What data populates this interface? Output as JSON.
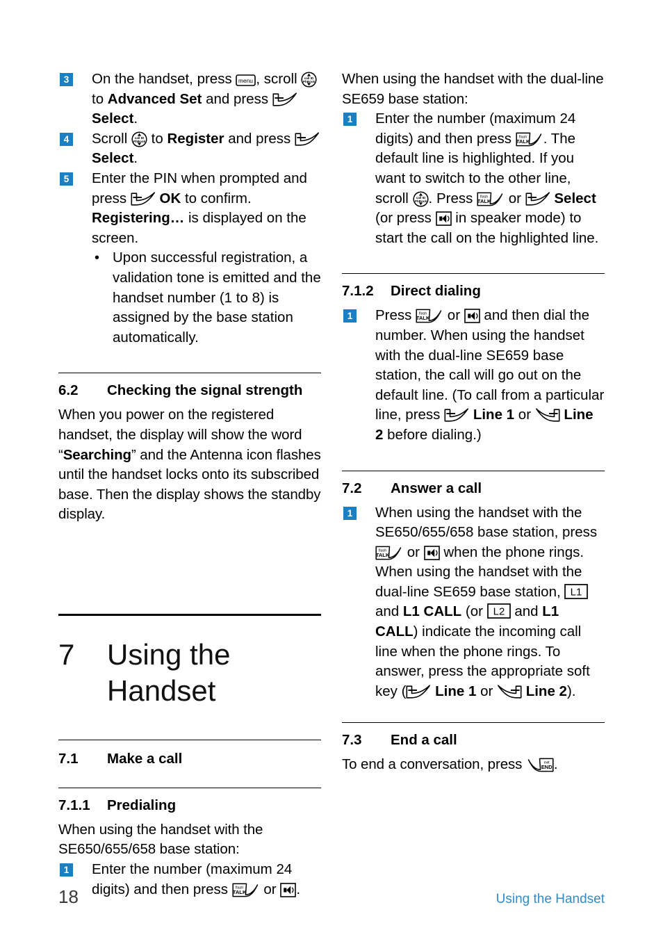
{
  "document": {
    "page_number": "18",
    "footer_title": "Using the Handset",
    "accent_blue": "#1B7FC3",
    "footer_blue": "#2C8ED1"
  },
  "icons": {
    "menu_key": "menu",
    "scroll_key_top": "call ID",
    "scroll_key_bottom": "PhBook",
    "talk_key_top": "flash",
    "talk_key_bottom": "TALK",
    "end_key_top": "exit",
    "end_key_bottom": "END",
    "speaker_key": "speaker-icon",
    "softkey_left": "left-softkey-icon",
    "softkey_right": "right-softkey-icon",
    "line1_key": "L1",
    "line2_key": "L2"
  },
  "left_column": {
    "steps": [
      {
        "num": "3",
        "parts": [
          {
            "t": "text",
            "v": "On the handset, press "
          },
          {
            "t": "icon",
            "v": "menu"
          },
          {
            "t": "text",
            "v": ", scroll "
          },
          {
            "t": "icon",
            "v": "scroll"
          },
          {
            "t": "text",
            "v": " to "
          },
          {
            "t": "bold",
            "v": "Advanced Set"
          },
          {
            "t": "text",
            "v": " and press "
          },
          {
            "t": "icon",
            "v": "softkey-left"
          },
          {
            "t": "text",
            "v": " "
          },
          {
            "t": "bold",
            "v": "Select"
          },
          {
            "t": "text",
            "v": "."
          }
        ]
      },
      {
        "num": "4",
        "parts": [
          {
            "t": "text",
            "v": "Scroll "
          },
          {
            "t": "icon",
            "v": "scroll"
          },
          {
            "t": "text",
            "v": " to "
          },
          {
            "t": "bold",
            "v": "Register"
          },
          {
            "t": "text",
            "v": " and press "
          },
          {
            "t": "icon",
            "v": "softkey-left"
          },
          {
            "t": "text",
            "v": " "
          },
          {
            "t": "bold",
            "v": "Select"
          },
          {
            "t": "text",
            "v": "."
          }
        ]
      },
      {
        "num": "5",
        "parts": [
          {
            "t": "text",
            "v": "Enter the PIN when prompted and press "
          },
          {
            "t": "icon",
            "v": "softkey-left"
          },
          {
            "t": "text",
            "v": " "
          },
          {
            "t": "bold",
            "v": "OK"
          },
          {
            "t": "text",
            "v": " to confirm. "
          },
          {
            "t": "bold",
            "v": "Registering…"
          },
          {
            "t": "text",
            "v": " is displayed on the screen."
          }
        ]
      }
    ],
    "bullet": "Upon successful registration, a validation tone is emitted and the handset number (1 to 8) is assigned by the base station automatically.",
    "section_6_2": {
      "number": "6.2",
      "title": "Checking the signal strength",
      "body_1": "When you power on the registered handset, the display will show the word “",
      "body_bold": "Searching",
      "body_2": "” and the Antenna icon flashes until the handset locks onto its subscribed base. Then the display shows the standby display."
    },
    "chapter_7": {
      "number": "7",
      "title": "Using the Handset"
    },
    "section_7_1": {
      "number": "7.1",
      "title": "Make a call"
    },
    "section_7_1_1": {
      "number": "7.1.1",
      "title": "Predialing",
      "intro": "When using the handset with the SE650/655/658 base station:",
      "step": {
        "num": "1",
        "parts": [
          {
            "t": "text",
            "v": "Enter the number (maximum 24 digits) and then press "
          },
          {
            "t": "icon",
            "v": "talk"
          },
          {
            "t": "text",
            "v": " or "
          },
          {
            "t": "icon",
            "v": "speaker"
          },
          {
            "t": "text",
            "v": "."
          }
        ]
      }
    }
  },
  "right_column": {
    "intro": "When using the handset with the dual-line SE659 base station:",
    "step_1": {
      "num": "1",
      "parts": [
        {
          "t": "text",
          "v": "Enter the number (maximum 24 digits) and then press "
        },
        {
          "t": "icon",
          "v": "talk"
        },
        {
          "t": "text",
          "v": ". The default line is highlighted. If you want to switch to the other line, scroll "
        },
        {
          "t": "icon",
          "v": "scroll"
        },
        {
          "t": "text",
          "v": ". Press "
        },
        {
          "t": "icon",
          "v": "talk"
        },
        {
          "t": "text",
          "v": " or "
        },
        {
          "t": "icon",
          "v": "softkey-left"
        },
        {
          "t": "text",
          "v": " "
        },
        {
          "t": "bold",
          "v": "Select"
        },
        {
          "t": "text",
          "v": " (or press "
        },
        {
          "t": "icon",
          "v": "speaker"
        },
        {
          "t": "text",
          "v": " in speaker mode) to start the call on the highlighted line."
        }
      ]
    },
    "section_7_1_2": {
      "number": "7.1.2",
      "title": "Direct dialing",
      "step": {
        "num": "1",
        "parts": [
          {
            "t": "text",
            "v": "Press "
          },
          {
            "t": "icon",
            "v": "talk"
          },
          {
            "t": "text",
            "v": " or "
          },
          {
            "t": "icon",
            "v": "speaker"
          },
          {
            "t": "text",
            "v": " and then dial the number. When using the handset with the dual-line SE659 base station, the call will go out on the default line. (To call from a particular line, press "
          },
          {
            "t": "icon",
            "v": "softkey-left"
          },
          {
            "t": "text",
            "v": " "
          },
          {
            "t": "bold",
            "v": "Line 1"
          },
          {
            "t": "text",
            "v": " or "
          },
          {
            "t": "icon",
            "v": "softkey-right"
          },
          {
            "t": "text",
            "v": " "
          },
          {
            "t": "bold",
            "v": "Line 2"
          },
          {
            "t": "text",
            "v": " before dialing.)"
          }
        ]
      }
    },
    "section_7_2": {
      "number": "7.2",
      "title": "Answer a call",
      "step": {
        "num": "1",
        "parts": [
          {
            "t": "text",
            "v": "When using the handset with the SE650/655/658 base station, press "
          },
          {
            "t": "icon",
            "v": "talk"
          },
          {
            "t": "text",
            "v": " or "
          },
          {
            "t": "icon",
            "v": "speaker"
          },
          {
            "t": "text",
            "v": " when the phone rings. When using the handset with the dual-line SE659 base station, "
          },
          {
            "t": "icon",
            "v": "L1"
          },
          {
            "t": "text",
            "v": " and "
          },
          {
            "t": "bold",
            "v": "L1 CALL"
          },
          {
            "t": "text",
            "v": " (or "
          },
          {
            "t": "icon",
            "v": "L2"
          },
          {
            "t": "text",
            "v": " and "
          },
          {
            "t": "bold",
            "v": "L1 CALL"
          },
          {
            "t": "text",
            "v": ") indicate the incoming call line when the phone rings. To answer, press the appropriate soft key ("
          },
          {
            "t": "icon",
            "v": "softkey-left"
          },
          {
            "t": "text",
            "v": " "
          },
          {
            "t": "bold",
            "v": "Line 1"
          },
          {
            "t": "text",
            "v": " or "
          },
          {
            "t": "icon",
            "v": "softkey-right"
          },
          {
            "t": "text",
            "v": " "
          },
          {
            "t": "bold",
            "v": "Line 2"
          },
          {
            "t": "text",
            "v": ")."
          }
        ]
      }
    },
    "section_7_3": {
      "number": "7.3",
      "title": "End a call",
      "body_parts": [
        {
          "t": "text",
          "v": "To end a conversation, press "
        },
        {
          "t": "icon",
          "v": "end"
        },
        {
          "t": "text",
          "v": "."
        }
      ]
    }
  }
}
